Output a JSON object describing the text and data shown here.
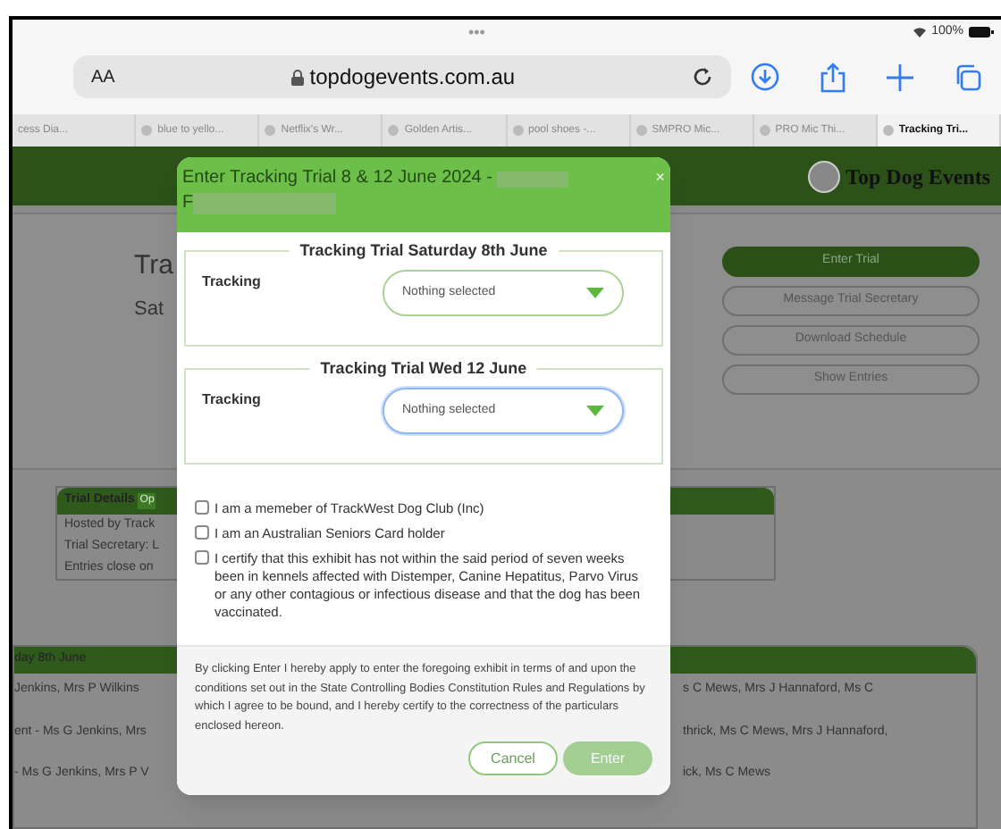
{
  "status_bar": {
    "dots": "•••",
    "battery": "100%"
  },
  "address_bar": {
    "text_size": "AA",
    "url": "topdogevents.com.au"
  },
  "tabs": [
    {
      "label": "cess Dia...",
      "selected": false
    },
    {
      "label": "blue to yello...",
      "selected": false
    },
    {
      "label": "Netflix's Wr...",
      "selected": false
    },
    {
      "label": "Golden Artis...",
      "selected": false
    },
    {
      "label": "pool shoes -...",
      "selected": false
    },
    {
      "label": "SMPRO Mic...",
      "selected": false
    },
    {
      "label": "PRO Mic Thi...",
      "selected": false
    },
    {
      "label": "Tracking Tri...",
      "selected": true
    }
  ],
  "site_header": {
    "logo": "Top Dog Events"
  },
  "page": {
    "title": "Tra",
    "subtitle": "Sat",
    "actions": [
      {
        "label": "Enter Trial",
        "kind": "primary"
      },
      {
        "label": "Message Trial Secretary",
        "kind": "secondary"
      },
      {
        "label": "Download Schedule",
        "kind": "secondary"
      },
      {
        "label": "Show Entries",
        "kind": "secondary"
      }
    ],
    "trial_details": {
      "heading": "Trial Details",
      "badge": "Op",
      "lines": [
        "Hosted by Track",
        "Trial Secretary: L",
        "Entries close on"
      ]
    },
    "schedule": {
      "heading": "day 8th June",
      "left_rows": [
        "Jenkins, Mrs P Wilkins",
        "ent - Ms G Jenkins, Mrs",
        "- Ms G Jenkins, Mrs P V"
      ],
      "right_rows": [
        "s C Mews, Mrs J Hannaford, Ms C",
        "thrick, Ms C Mews, Mrs J Hannaford,",
        "ick, Ms C Mews"
      ]
    }
  },
  "modal": {
    "title": "Enter Tracking Trial 8 & 12 June 2024 -",
    "title_line_2": "F",
    "close": "×",
    "sections": [
      {
        "legend": "Tracking Trial Saturday 8th June",
        "label": "Tracking",
        "placeholder": "Nothing selected",
        "focused": false
      },
      {
        "legend": "Tracking Trial Wed 12 June",
        "label": "Tracking",
        "placeholder": "Nothing selected",
        "focused": true
      }
    ],
    "checkboxes": [
      {
        "label": "I am a memeber of TrackWest Dog Club (Inc)",
        "checked": false
      },
      {
        "label": "I am an Australian Seniors Card holder",
        "checked": false
      },
      {
        "label": "I certify that this exhibit has not within the said period of seven weeks been in kennels affected with Distemper, Canine Hepatitus, Parvo Virus or any other contagious or infectious disease and that the dog has been vaccinated.",
        "checked": false
      }
    ],
    "declaration": "By clicking Enter I hereby apply to enter the foregoing exhibit in terms of and upon the conditions set out in the State Controlling Bodies Constitution Rules and Regulations by which I agree to be bound, and I hereby certify to the correctness of the particulars enclosed hereon.",
    "buttons": [
      {
        "label": "Cancel",
        "kind": "outline",
        "disabled": false
      },
      {
        "label": "Enter",
        "kind": "primary",
        "disabled": true
      }
    ]
  }
}
